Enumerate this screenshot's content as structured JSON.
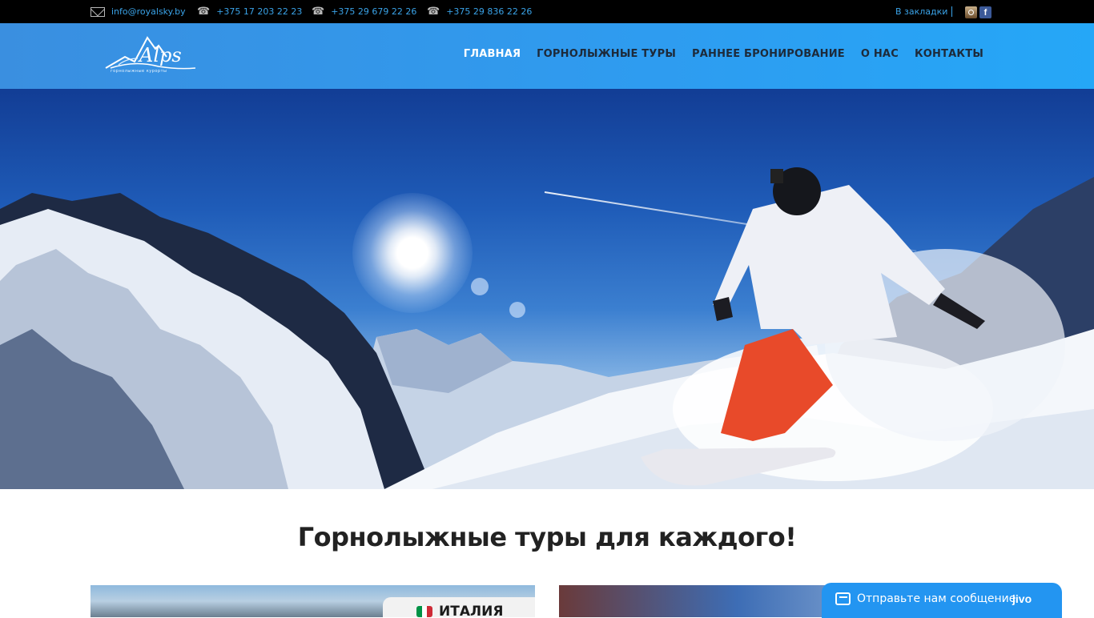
{
  "topbar": {
    "email": "info@royalsky.by",
    "phones": [
      "+375 17 203 22 23",
      "+375 29 679 22 26",
      "+375 29 836 22 26"
    ],
    "bookmark_label": "В закладки",
    "social": {
      "instagram_icon": "instagram-icon",
      "facebook_icon": "facebook-icon",
      "facebook_glyph": "f"
    }
  },
  "header": {
    "logo_text": "Alps",
    "logo_subtitle": "горнолыжные курорты",
    "nav": [
      {
        "label": "ГЛАВНАЯ",
        "active": true
      },
      {
        "label": "ГОРНОЛЫЖНЫЕ ТУРЫ",
        "active": false
      },
      {
        "label": "РАННЕЕ БРОНИРОВАНИЕ",
        "active": false
      },
      {
        "label": "О НАС",
        "active": false
      },
      {
        "label": "КОНТАКТЫ",
        "active": false
      }
    ]
  },
  "main": {
    "section_title": "Горнолыжные туры для каждого!",
    "cards": [
      {
        "tag": "ИТАЛИЯ",
        "flag_colors": [
          "#009246",
          "#ffffff",
          "#ce2b37"
        ]
      }
    ]
  },
  "chat": {
    "label": "Отправьте нам сообщение",
    "brand": "jivo"
  },
  "colors": {
    "topbar_bg": "#000000",
    "topbar_text": "#3aa3e8",
    "header_bg": "#2e9cf0",
    "nav_text": "#1d2a3a",
    "nav_active": "#ffffff",
    "chat_bg": "#2395f1"
  }
}
